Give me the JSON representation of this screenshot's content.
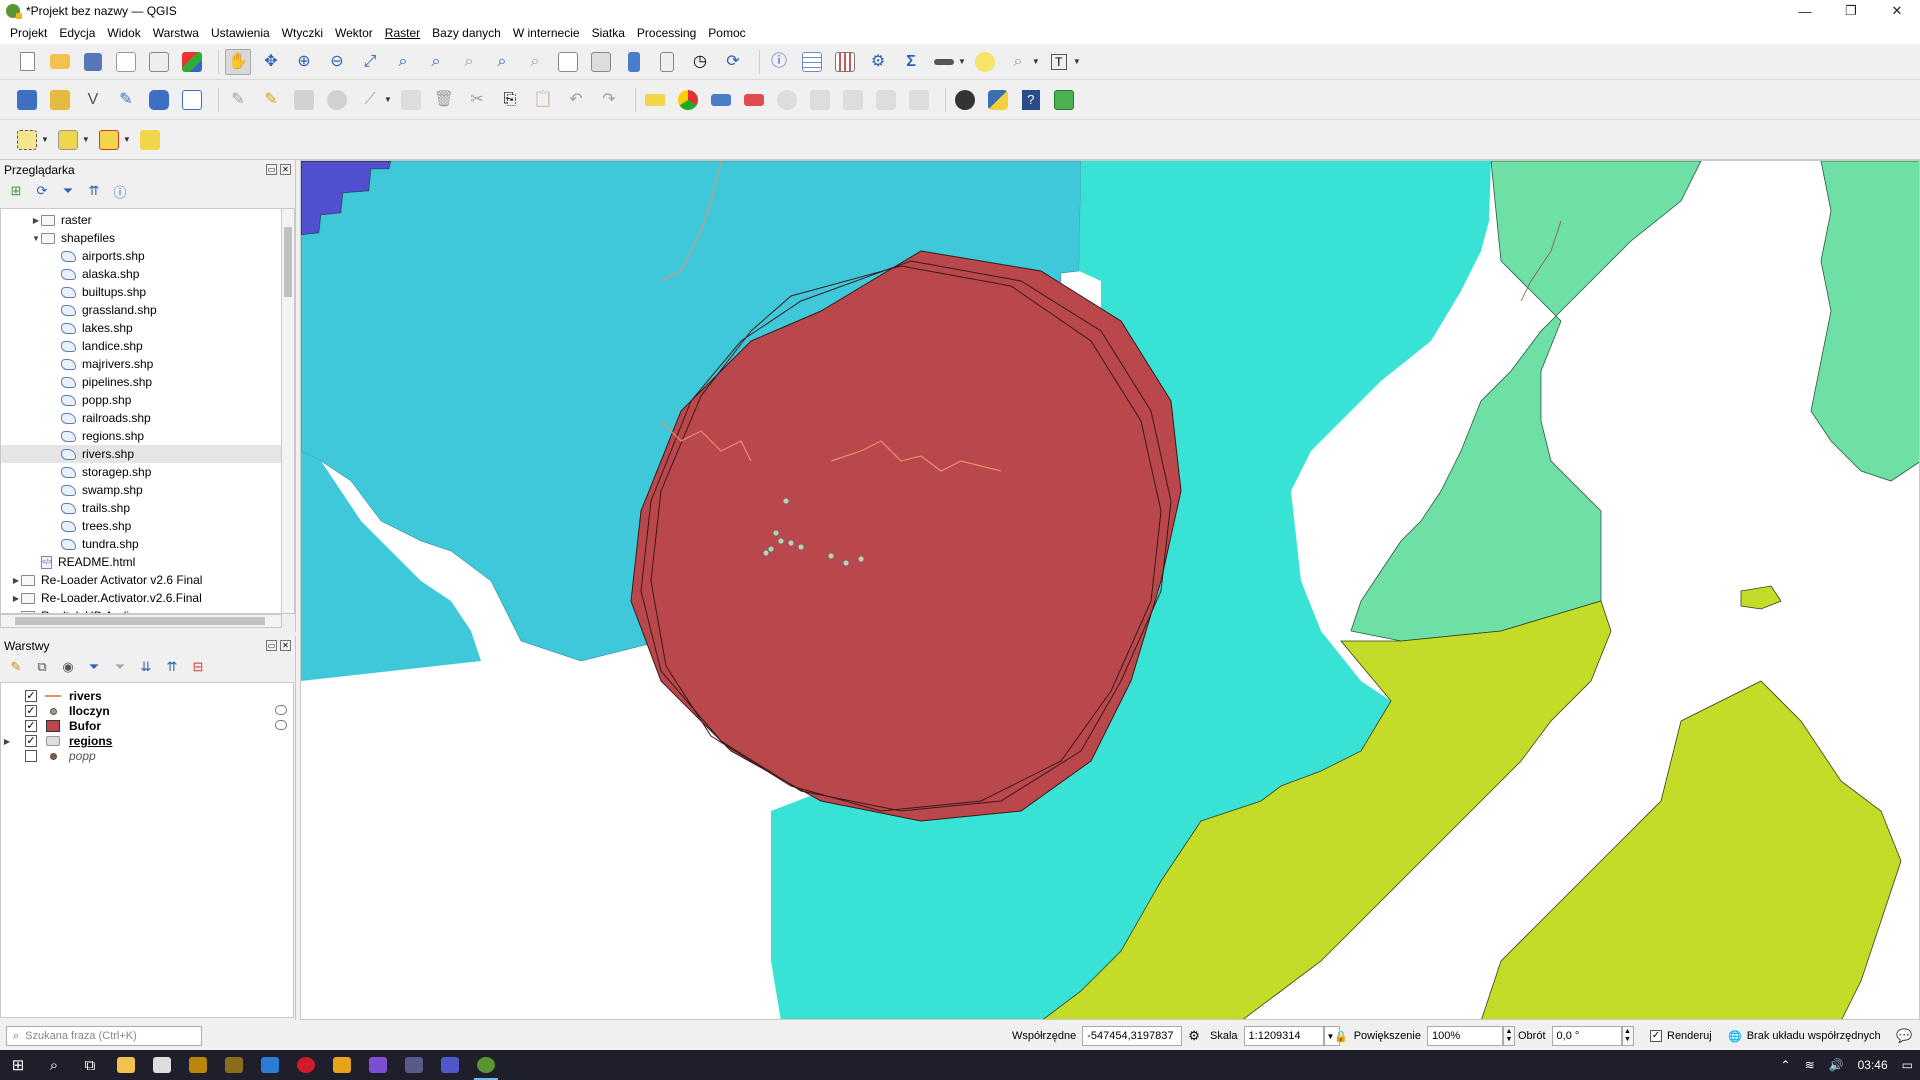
{
  "window": {
    "title": "*Projekt bez nazwy — QGIS",
    "minimize": "—",
    "restore": "❐",
    "close": "✕"
  },
  "menu": [
    "Projekt",
    "Edycja",
    "Widok",
    "Warstwa",
    "Ustawienia",
    "Wtyczki",
    "Wektor",
    "Raster",
    "Bazy danych",
    "W internecie",
    "Siatka",
    "Processing",
    "Pomoc"
  ],
  "browser": {
    "title": "Przeglądarka",
    "items": [
      {
        "label": "raster",
        "type": "folder",
        "indent": 2,
        "arrow": "▶"
      },
      {
        "label": "shapefiles",
        "type": "folder",
        "indent": 2,
        "arrow": "▼"
      },
      {
        "label": "airports.shp",
        "type": "shp",
        "indent": 3
      },
      {
        "label": "alaska.shp",
        "type": "shp",
        "indent": 3
      },
      {
        "label": "builtups.shp",
        "type": "shp",
        "indent": 3
      },
      {
        "label": "grassland.shp",
        "type": "shp",
        "indent": 3
      },
      {
        "label": "lakes.shp",
        "type": "shp",
        "indent": 3
      },
      {
        "label": "landice.shp",
        "type": "shp",
        "indent": 3
      },
      {
        "label": "majrivers.shp",
        "type": "shp",
        "indent": 3
      },
      {
        "label": "pipelines.shp",
        "type": "shp",
        "indent": 3
      },
      {
        "label": "popp.shp",
        "type": "shp",
        "indent": 3
      },
      {
        "label": "railroads.shp",
        "type": "shp",
        "indent": 3
      },
      {
        "label": "regions.shp",
        "type": "shp",
        "indent": 3
      },
      {
        "label": "rivers.shp",
        "type": "shp",
        "indent": 3,
        "selected": true
      },
      {
        "label": "storagep.shp",
        "type": "shp",
        "indent": 3
      },
      {
        "label": "swamp.shp",
        "type": "shp",
        "indent": 3
      },
      {
        "label": "trails.shp",
        "type": "shp",
        "indent": 3
      },
      {
        "label": "trees.shp",
        "type": "shp",
        "indent": 3
      },
      {
        "label": "tundra.shp",
        "type": "shp",
        "indent": 3
      },
      {
        "label": "README.html",
        "type": "html",
        "indent": 2
      },
      {
        "label": "Re-Loader Activator v2.6 Final",
        "type": "folder",
        "indent": 1,
        "arrow": "▶"
      },
      {
        "label": "Re-Loader.Activator.v2.6.Final",
        "type": "folder",
        "indent": 1,
        "arrow": "▶"
      },
      {
        "label": "Realtek HD Audio",
        "type": "folder",
        "indent": 1,
        "arrow": "▶"
      }
    ]
  },
  "layers": {
    "title": "Warstwy",
    "items": [
      {
        "label": "rivers",
        "checked": true,
        "symbol": "line",
        "color": "#e8906a",
        "style": "bold"
      },
      {
        "label": "Iloczyn",
        "checked": true,
        "symbol": "point",
        "color": "#9aa07e",
        "style": "bold",
        "eye": true
      },
      {
        "label": "Bufor",
        "checked": true,
        "symbol": "fill",
        "color": "#b9474c",
        "style": "bold",
        "eye": true
      },
      {
        "label": "regions",
        "checked": true,
        "symbol": "group",
        "color": "#aaaaaa",
        "style": "underline",
        "expand": "▶"
      },
      {
        "label": "popp",
        "checked": false,
        "symbol": "point",
        "color": "#8b5a3c",
        "style": "italic"
      }
    ]
  },
  "status": {
    "search_placeholder": "Szukana fraza (Ctrl+K)",
    "coord_label": "Współrzędne",
    "coord_value": "-547454,3197837",
    "scale_label": "Skala",
    "scale_value": "1:1209314",
    "magnifier_label": "Powiększenie",
    "magnifier_value": "100%",
    "rotation_label": "Obrót",
    "rotation_value": "0,0 °",
    "render_label": "Renderuj",
    "crs_label": "Brak układu współrzędnych"
  },
  "taskbar": {
    "time": "03:46"
  },
  "colors": {
    "blue_region": "#4f4fcf",
    "cyan_region": "#3ec8da",
    "teal_region": "#38e3d5",
    "green_region": "#6ee0a6",
    "lime_region": "#c4dc28",
    "buffer_fill": "#b9474c",
    "buffer_stroke": "#3a1a1a",
    "river": "#e8906a",
    "points": "#c9c9b3"
  }
}
